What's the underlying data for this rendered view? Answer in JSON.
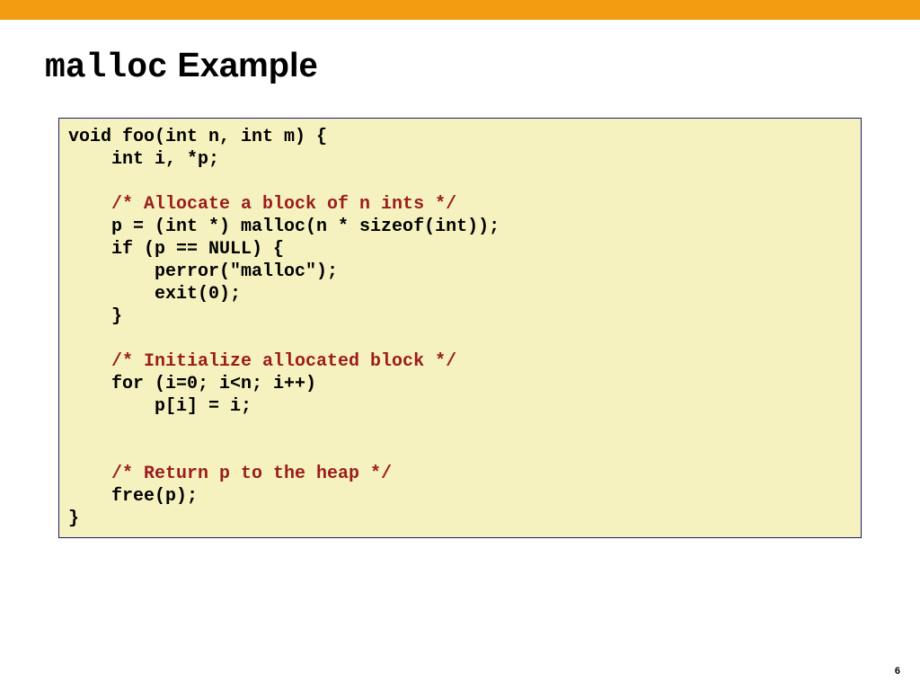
{
  "title": {
    "mono": "malloc",
    "rest": " Example"
  },
  "code": {
    "l01": "void foo(int n, int m) {",
    "l02": "    int i, *p;",
    "l03": "",
    "l04": "    /* Allocate a block of n ints */",
    "l05": "    p = (int *) malloc(n * sizeof(int));",
    "l06": "    if (p == NULL) {",
    "l07": "        perror(\"malloc\");",
    "l08": "        exit(0);",
    "l09": "    }",
    "l10": "",
    "l11": "    /* Initialize allocated block */",
    "l12": "    for (i=0; i<n; i++)",
    "l13": "        p[i] = i;",
    "l14": "",
    "l15": "",
    "l16": "    /* Return p to the heap */",
    "l17": "    free(p);",
    "l18": "}"
  },
  "page_number": "6"
}
